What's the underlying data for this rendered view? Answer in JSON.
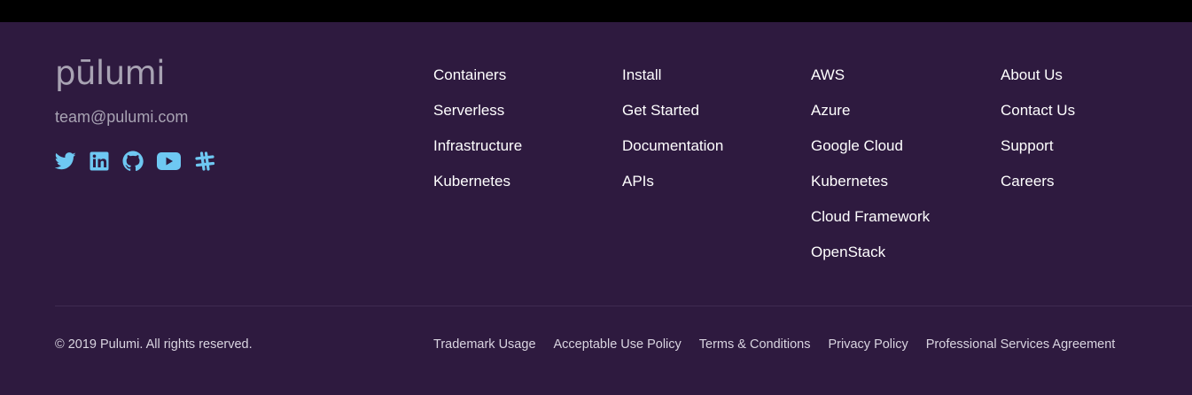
{
  "brand": {
    "logo_text": "pūlumi",
    "email": "team@pulumi.com"
  },
  "social": [
    {
      "icon": "twitter-icon",
      "color": "#6ec8f2"
    },
    {
      "icon": "linkedin-icon",
      "color": "#6ec8f2"
    },
    {
      "icon": "github-icon",
      "color": "#6ec8f2"
    },
    {
      "icon": "youtube-icon",
      "color": "#6ec8f2"
    },
    {
      "icon": "slack-icon",
      "color": "#6ec8f2"
    }
  ],
  "columns": [
    {
      "links": [
        "Containers",
        "Serverless",
        "Infrastructure",
        "Kubernetes"
      ]
    },
    {
      "links": [
        "Install",
        "Get Started",
        "Documentation",
        "APIs"
      ]
    },
    {
      "links": [
        "AWS",
        "Azure",
        "Google Cloud",
        "Kubernetes",
        "Cloud Framework",
        "OpenStack"
      ]
    },
    {
      "links": [
        "About Us",
        "Contact Us",
        "Support",
        "Careers"
      ]
    }
  ],
  "bottom": {
    "copyright": "© 2019 Pulumi. All rights reserved.",
    "legal_links": [
      "Trademark Usage",
      "Acceptable Use Policy",
      "Terms & Conditions",
      "Privacy Policy",
      "Professional Services Agreement"
    ]
  },
  "colors": {
    "background": "#2e1a3f",
    "topbar": "#000000",
    "link": "#ffffff",
    "muted": "#a8a3b3",
    "social": "#6ec8f2"
  }
}
